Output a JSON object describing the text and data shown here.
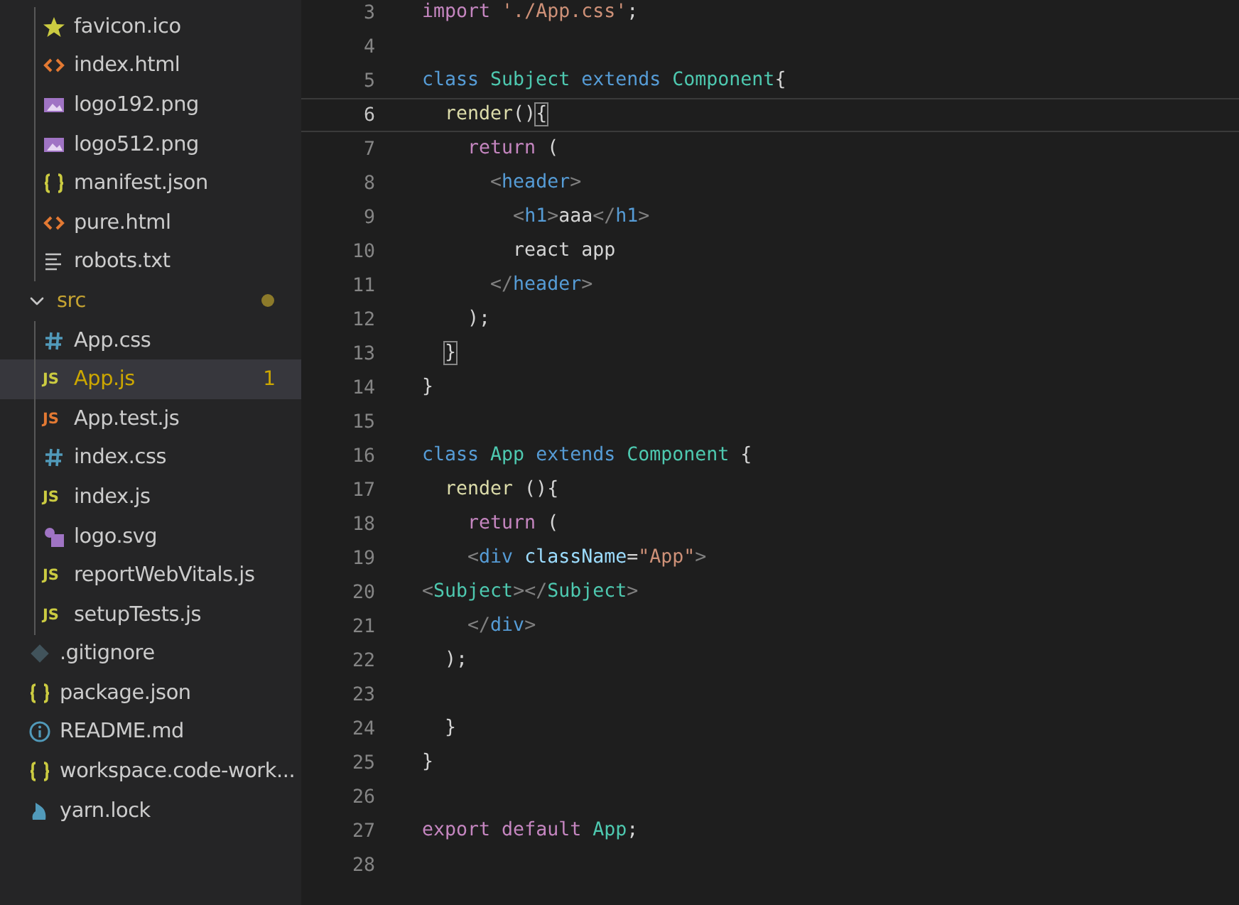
{
  "explorer": {
    "tree": [
      {
        "kind": "group",
        "children": [
          {
            "kind": "star",
            "name": "favicon.ico",
            "selected": false
          },
          {
            "kind": "html",
            "name": "index.html",
            "selected": false
          },
          {
            "kind": "image",
            "name": "logo192.png",
            "selected": false
          },
          {
            "kind": "image",
            "name": "logo512.png",
            "selected": false
          },
          {
            "kind": "json",
            "name": "manifest.json",
            "selected": false
          },
          {
            "kind": "html",
            "name": "pure.html",
            "selected": false
          },
          {
            "kind": "text",
            "name": "robots.txt",
            "selected": false
          }
        ]
      },
      {
        "kind": "folder",
        "name": "src",
        "expanded": true,
        "modified": true,
        "selected": false,
        "children": [
          {
            "kind": "css",
            "name": "App.css",
            "selected": false
          },
          {
            "kind": "js",
            "icon_label": "JS",
            "name": "App.js",
            "selected": true,
            "problems": "1"
          },
          {
            "kind": "jstest",
            "icon_label": "JS",
            "name": "App.test.js",
            "selected": false
          },
          {
            "kind": "css",
            "name": "index.css",
            "selected": false
          },
          {
            "kind": "js",
            "icon_label": "JS",
            "name": "index.js",
            "selected": false
          },
          {
            "kind": "svg",
            "name": "logo.svg",
            "selected": false
          },
          {
            "kind": "js",
            "icon_label": "JS",
            "name": "reportWebVitals.js",
            "selected": false
          },
          {
            "kind": "js",
            "icon_label": "JS",
            "name": "setupTests.js",
            "selected": false
          }
        ]
      },
      {
        "kind": "git",
        "name": ".gitignore",
        "selected": false
      },
      {
        "kind": "json",
        "name": "package.json",
        "selected": false
      },
      {
        "kind": "info",
        "name": "README.md",
        "selected": false
      },
      {
        "kind": "json",
        "name": "workspace.code-work...",
        "selected": false
      },
      {
        "kind": "yarn",
        "name": "yarn.lock",
        "selected": false
      }
    ]
  },
  "editor": {
    "lines": [
      {
        "number": "3",
        "current": false,
        "tokens": [
          {
            "text": "import",
            "kind": "keyword"
          },
          {
            "text": " './App.css'",
            "kind": "string"
          },
          {
            "text": ";",
            "kind": "plain"
          }
        ]
      },
      {
        "number": "4",
        "current": false
      },
      {
        "number": "5",
        "current": false,
        "tokens": [
          {
            "text": "class",
            "kind": "storage"
          },
          {
            "text": " Subject",
            "kind": "type"
          },
          {
            "text": " extends",
            "kind": "storage"
          },
          {
            "text": " Component",
            "kind": "type"
          },
          {
            "text": "{",
            "kind": "plain"
          }
        ]
      },
      {
        "number": "6",
        "current": true,
        "tokens": [
          {
            "text": "  render",
            "kind": "function"
          },
          {
            "text": "()",
            "kind": "plain"
          },
          {
            "text": "{",
            "kind": "matched"
          }
        ]
      },
      {
        "number": "7",
        "current": false,
        "tokens": [
          {
            "text": "    return",
            "kind": "keyword"
          },
          {
            "text": " (",
            "kind": "plain"
          }
        ]
      },
      {
        "number": "8",
        "current": false,
        "tokens": [
          {
            "text": "      <",
            "kind": "punct"
          },
          {
            "text": "header",
            "kind": "tag"
          },
          {
            "text": ">",
            "kind": "punct"
          }
        ]
      },
      {
        "number": "9",
        "current": false,
        "tokens": [
          {
            "text": "        <",
            "kind": "punct"
          },
          {
            "text": "h1",
            "kind": "tag"
          },
          {
            "text": ">",
            "kind": "punct"
          },
          {
            "text": "aaa",
            "kind": "plain"
          },
          {
            "text": "</",
            "kind": "punct"
          },
          {
            "text": "h1",
            "kind": "tag"
          },
          {
            "text": ">",
            "kind": "punct"
          }
        ]
      },
      {
        "number": "10",
        "current": false,
        "tokens": [
          {
            "text": "        react app",
            "kind": "plain"
          }
        ]
      },
      {
        "number": "11",
        "current": false,
        "tokens": [
          {
            "text": "      </",
            "kind": "punct"
          },
          {
            "text": "header",
            "kind": "tag"
          },
          {
            "text": ">",
            "kind": "punct"
          }
        ]
      },
      {
        "number": "12",
        "current": false,
        "tokens": [
          {
            "text": "    );",
            "kind": "plain"
          }
        ]
      },
      {
        "number": "13",
        "current": false,
        "tokens": [
          {
            "text": "  }",
            "kind": "matched"
          }
        ]
      },
      {
        "number": "14",
        "current": false,
        "tokens": [
          {
            "text": "}",
            "kind": "plain"
          }
        ]
      },
      {
        "number": "15",
        "current": false
      },
      {
        "number": "16",
        "current": false,
        "tokens": [
          {
            "text": "class",
            "kind": "storage"
          },
          {
            "text": " App",
            "kind": "type"
          },
          {
            "text": " extends",
            "kind": "storage"
          },
          {
            "text": " Component",
            "kind": "type"
          },
          {
            "text": " {",
            "kind": "plain"
          }
        ]
      },
      {
        "number": "17",
        "current": false,
        "tokens": [
          {
            "text": "  render",
            "kind": "function"
          },
          {
            "text": " (){",
            "kind": "plain"
          }
        ]
      },
      {
        "number": "18",
        "current": false,
        "tokens": [
          {
            "text": "    return",
            "kind": "keyword"
          },
          {
            "text": " (",
            "kind": "plain"
          }
        ]
      },
      {
        "number": "19",
        "current": false,
        "tokens": [
          {
            "text": "    <",
            "kind": "punct"
          },
          {
            "text": "div",
            "kind": "tag"
          },
          {
            "text": " className",
            "kind": "attr"
          },
          {
            "text": "=",
            "kind": "plain"
          },
          {
            "text": "\"App\"",
            "kind": "string"
          },
          {
            "text": ">",
            "kind": "punct"
          }
        ]
      },
      {
        "number": "20",
        "current": false,
        "tokens": [
          {
            "text": "<",
            "kind": "punct"
          },
          {
            "text": "Subject",
            "kind": "type"
          },
          {
            "text": "></",
            "kind": "punct"
          },
          {
            "text": "Subject",
            "kind": "type"
          },
          {
            "text": ">",
            "kind": "punct"
          }
        ]
      },
      {
        "number": "21",
        "current": false,
        "tokens": [
          {
            "text": "    </",
            "kind": "punct"
          },
          {
            "text": "div",
            "kind": "tag"
          },
          {
            "text": ">",
            "kind": "punct"
          }
        ]
      },
      {
        "number": "22",
        "current": false,
        "tokens": [
          {
            "text": "  );",
            "kind": "plain"
          }
        ]
      },
      {
        "number": "23",
        "current": false
      },
      {
        "number": "24",
        "current": false,
        "tokens": [
          {
            "text": "  }",
            "kind": "plain"
          }
        ]
      },
      {
        "number": "25",
        "current": false,
        "tokens": [
          {
            "text": "}",
            "kind": "plain"
          }
        ]
      },
      {
        "number": "26",
        "current": false
      },
      {
        "number": "27",
        "current": false,
        "tokens": [
          {
            "text": "export",
            "kind": "keyword"
          },
          {
            "text": " default",
            "kind": "keyword"
          },
          {
            "text": " App",
            "kind": "type"
          },
          {
            "text": ";",
            "kind": "plain"
          }
        ]
      },
      {
        "number": "28",
        "current": false
      }
    ]
  }
}
